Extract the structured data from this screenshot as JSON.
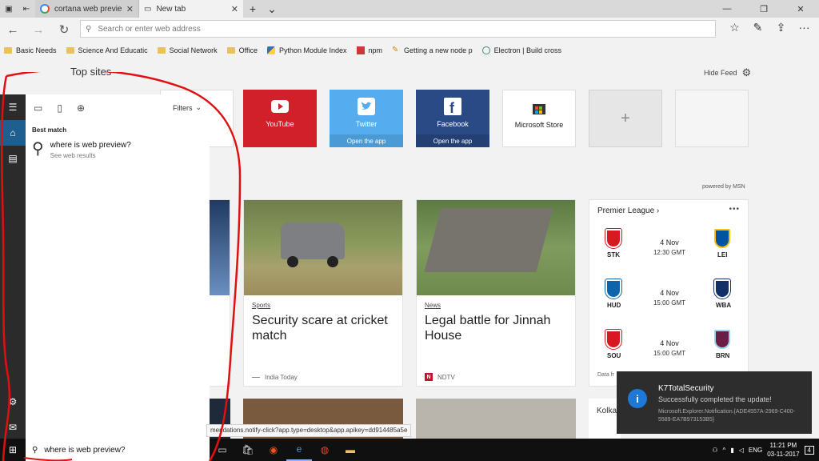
{
  "tabs": [
    {
      "title": "cortana web preview is not",
      "close": "✕"
    },
    {
      "title": "New tab",
      "close": "✕"
    }
  ],
  "address": {
    "placeholder": "Search or enter web address"
  },
  "favorites": [
    {
      "label": "Basic Needs",
      "icon": "folder-icon"
    },
    {
      "label": "Science And Educatic",
      "icon": "folder-icon"
    },
    {
      "label": "Social Network",
      "icon": "folder-icon"
    },
    {
      "label": "Office",
      "icon": "folder-icon"
    },
    {
      "label": "Python Module Index",
      "icon": "python-icon"
    },
    {
      "label": "npm",
      "icon": "npm-icon"
    },
    {
      "label": "Getting a new node p",
      "icon": "pencil-icon"
    },
    {
      "label": "Electron | Build cross",
      "icon": "electron-icon"
    }
  ],
  "page": {
    "top_sites_label": "Top sites",
    "hide_feed": "Hide Feed",
    "powered_by": "powered by MSN"
  },
  "tiles": {
    "youtube": {
      "label": "YouTube"
    },
    "twitter": {
      "label": "Twitter",
      "sub": "Open the app"
    },
    "facebook": {
      "label": "Facebook",
      "sub": "Open the app"
    },
    "store": {
      "label": "Microsoft Store"
    },
    "add": {
      "label": "+"
    }
  },
  "news": [
    {
      "category": "Sports",
      "headline": "Security scare at cricket match",
      "source": "India Today"
    },
    {
      "category": "News",
      "headline": "Legal battle for Jinnah House",
      "source": "NDTV"
    }
  ],
  "premier_league": {
    "title": "Premier League",
    "more": "•••",
    "matches": [
      {
        "home": "STK",
        "away": "LEI",
        "date": "4 Nov",
        "time": "12:30 GMT"
      },
      {
        "home": "HUD",
        "away": "WBA",
        "date": "4 Nov",
        "time": "15:00 GMT"
      },
      {
        "home": "SOU",
        "away": "BRN",
        "date": "4 Nov",
        "time": "15:00 GMT"
      }
    ],
    "data_from": "Data fr"
  },
  "kolka": "Kolka",
  "cortana": {
    "filters": "Filters",
    "best_match": "Best match",
    "result_query": "where is web preview?",
    "result_sub": "See web results",
    "search_text": "where is web preview?"
  },
  "status_url": "mendations.notify-click?app.type=desktop&app.apikey=dd914485a5e",
  "toast": {
    "title": "K7TotalSecurity",
    "message": "Successfully completed the update!",
    "source": "Microsoft.Explorer.Notification.{ADE4557A-2969-C400-5589-EA7B973153B5}"
  },
  "clock": {
    "time": "11:21 PM",
    "date": "03-11-2017"
  },
  "tray": {
    "lang": "ENG",
    "notifications": "4"
  },
  "colors": {
    "youtube": "#d2202a",
    "twitter": "#55acee",
    "facebook": "#2a4a86",
    "annotation": "#e01010"
  }
}
